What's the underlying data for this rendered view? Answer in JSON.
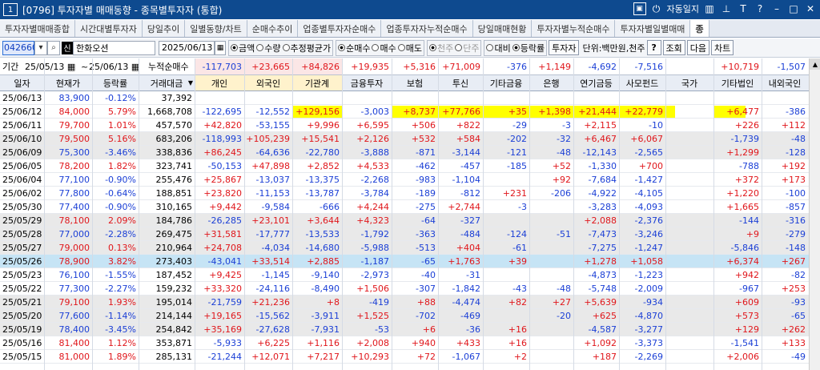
{
  "window": {
    "num": "1",
    "title": "[0796] 투자자별 매매동향 - 종목별투자자 (통합)",
    "autosave": "자동일지",
    "icons": [
      "window-box-icon",
      "power-icon",
      "pin-icon",
      "text-icon",
      "help-icon",
      "minimize-icon",
      "maximize-icon",
      "close-icon"
    ]
  },
  "tabs": [
    "투자자별매매종합",
    "시간대별투자자",
    "당일추이",
    "일별동향/차트",
    "순매수추이",
    "업종별투자자순매수",
    "업종투자자누적순매수",
    "당일매매현황",
    "투자자별누적순매수",
    "투자자별일별매매",
    "종"
  ],
  "controls": {
    "code": "042660",
    "market_badge": "신",
    "stock_name": "한화오션",
    "date": "2025/06/13",
    "metric_options": [
      "금액",
      "수량",
      "추정평균가"
    ],
    "metric_selected": 0,
    "trade_options": [
      "순매수",
      "매수",
      "매도"
    ],
    "trade_selected": 0,
    "scope_options": [
      "천주",
      "단주"
    ],
    "compare_options": [
      "대비",
      "등락률"
    ],
    "compare_selected": 1,
    "investor_button": "투자자",
    "unit": "단위:백만원,천주",
    "help": "?",
    "query": "조회",
    "next": "다음",
    "chart": "차트"
  },
  "period": {
    "label": "기간",
    "from": "25/05/13",
    "to": "25/06/13",
    "cum_label": "누적순매수",
    "cum_values": [
      "-117,703",
      "+23,665",
      "+84,826",
      "+19,935",
      "+5,316",
      "+71,009",
      "-376",
      "+1,149",
      "-4,692",
      "-7,516",
      "",
      "+10,719",
      "-1,507"
    ]
  },
  "columns": [
    "일자",
    "현재가",
    "등락률",
    "거래대금",
    "개인",
    "외국인",
    "기관계",
    "금융투자",
    "보험",
    "투신",
    "기타금융",
    "은행",
    "연기금등",
    "사모펀드",
    "국가",
    "기타법인",
    "내외국인"
  ],
  "rows": [
    {
      "d": "25/06/13",
      "p": "83,900",
      "r": "-0.12%",
      "a": "37,392",
      "v": [
        "",
        "",
        "",
        "",
        "",
        "",
        "",
        "",
        "",
        "",
        "",
        "",
        ""
      ]
    },
    {
      "d": "25/06/12",
      "p": "84,000",
      "r": "5.79%",
      "a": "1,668,708",
      "v": [
        "-122,695",
        "-12,552",
        "+129,156",
        "-3,003",
        "+8,737",
        "+77,766",
        "+35",
        "+1,398",
        "+21,444",
        "+22,779",
        "",
        "+6,477",
        "-386"
      ]
    },
    {
      "d": "25/06/11",
      "p": "79,700",
      "r": "1.01%",
      "a": "457,570",
      "v": [
        "+42,820",
        "-53,155",
        "+9,996",
        "+6,595",
        "+506",
        "+822",
        "-29",
        "-3",
        "+2,115",
        "-10",
        "",
        "+226",
        "+112"
      ]
    },
    {
      "d": "25/06/10",
      "p": "79,500",
      "r": "5.16%",
      "a": "683,206",
      "v": [
        "-118,993",
        "+105,239",
        "+15,541",
        "+2,126",
        "+532",
        "+584",
        "-202",
        "-32",
        "+6,467",
        "+6,067",
        "",
        "-1,739",
        "-48"
      ]
    },
    {
      "d": "25/06/09",
      "p": "75,300",
      "r": "-3.46%",
      "a": "338,836",
      "v": [
        "+86,245",
        "-64,636",
        "-22,780",
        "-3,888",
        "-871",
        "-3,144",
        "-121",
        "-48",
        "-12,143",
        "-2,565",
        "",
        "+1,299",
        "-128"
      ]
    },
    {
      "d": "25/06/05",
      "p": "78,200",
      "r": "1.82%",
      "a": "323,741",
      "v": [
        "-50,153",
        "+47,898",
        "+2,852",
        "+4,533",
        "-462",
        "-457",
        "-185",
        "+52",
        "-1,330",
        "+700",
        "",
        "-788",
        "+192"
      ]
    },
    {
      "d": "25/06/04",
      "p": "77,100",
      "r": "-0.90%",
      "a": "255,476",
      "v": [
        "+25,867",
        "-13,037",
        "-13,375",
        "-2,268",
        "-983",
        "-1,104",
        "",
        "+92",
        "-7,684",
        "-1,427",
        "",
        "+372",
        "+173"
      ]
    },
    {
      "d": "25/06/02",
      "p": "77,800",
      "r": "-0.64%",
      "a": "188,851",
      "v": [
        "+23,820",
        "-11,153",
        "-13,787",
        "-3,784",
        "-189",
        "-812",
        "+231",
        "-206",
        "-4,922",
        "-4,105",
        "",
        "+1,220",
        "-100"
      ]
    },
    {
      "d": "25/05/30",
      "p": "77,400",
      "r": "-0.90%",
      "a": "310,165",
      "v": [
        "+9,442",
        "-9,584",
        "-666",
        "+4,244",
        "-275",
        "+2,744",
        "-3",
        "",
        "-3,283",
        "-4,093",
        "",
        "+1,665",
        "-857"
      ]
    },
    {
      "d": "25/05/29",
      "p": "78,100",
      "r": "2.09%",
      "a": "184,786",
      "v": [
        "-26,285",
        "+23,101",
        "+3,644",
        "+4,323",
        "-64",
        "-327",
        "",
        "",
        "+2,088",
        "-2,376",
        "",
        "-144",
        "-316"
      ]
    },
    {
      "d": "25/05/28",
      "p": "77,000",
      "r": "-2.28%",
      "a": "269,475",
      "v": [
        "+31,581",
        "-17,777",
        "-13,533",
        "-1,792",
        "-363",
        "-484",
        "-124",
        "-51",
        "-7,473",
        "-3,246",
        "",
        "+9",
        "-279"
      ]
    },
    {
      "d": "25/05/27",
      "p": "79,000",
      "r": "0.13%",
      "a": "210,964",
      "v": [
        "+24,708",
        "-4,034",
        "-14,680",
        "-5,988",
        "-513",
        "+404",
        "-61",
        "",
        "-7,275",
        "-1,247",
        "",
        "-5,846",
        "-148"
      ]
    },
    {
      "d": "25/05/26",
      "p": "78,900",
      "r": "3.82%",
      "a": "273,403",
      "v": [
        "-43,041",
        "+33,514",
        "+2,885",
        "-1,187",
        "-65",
        "+1,763",
        "+39",
        "",
        "+1,278",
        "+1,058",
        "",
        "+6,374",
        "+267"
      ]
    },
    {
      "d": "25/05/23",
      "p": "76,100",
      "r": "-1.55%",
      "a": "187,452",
      "v": [
        "+9,425",
        "-1,145",
        "-9,140",
        "-2,973",
        "-40",
        "-31",
        "",
        "",
        "-4,873",
        "-1,223",
        "",
        "+942",
        "-82"
      ]
    },
    {
      "d": "25/05/22",
      "p": "77,300",
      "r": "-2.27%",
      "a": "159,232",
      "v": [
        "+33,320",
        "-24,116",
        "-8,490",
        "+1,506",
        "-307",
        "-1,842",
        "-43",
        "-48",
        "-5,748",
        "-2,009",
        "",
        "-967",
        "+253"
      ]
    },
    {
      "d": "25/05/21",
      "p": "79,100",
      "r": "1.93%",
      "a": "195,014",
      "v": [
        "-21,759",
        "+21,236",
        "+8",
        "-419",
        "+88",
        "-4,474",
        "+82",
        "+27",
        "+5,639",
        "-934",
        "",
        "+609",
        "-93"
      ]
    },
    {
      "d": "25/05/20",
      "p": "77,600",
      "r": "-1.14%",
      "a": "214,144",
      "v": [
        "+19,165",
        "-15,562",
        "-3,911",
        "+1,525",
        "-702",
        "-469",
        "",
        "-20",
        "+625",
        "-4,870",
        "",
        "+573",
        "-65"
      ]
    },
    {
      "d": "25/05/19",
      "p": "78,400",
      "r": "-3.45%",
      "a": "254,842",
      "v": [
        "+35,169",
        "-27,628",
        "-7,931",
        "-53",
        "+6",
        "-36",
        "+16",
        "",
        "-4,587",
        "-3,277",
        "",
        "+129",
        "+262"
      ]
    },
    {
      "d": "25/05/16",
      "p": "81,400",
      "r": "1.12%",
      "a": "353,871",
      "v": [
        "-5,933",
        "+6,225",
        "+1,116",
        "+2,008",
        "+940",
        "+433",
        "+16",
        "",
        "+1,092",
        "-3,373",
        "",
        "-1,541",
        "+133"
      ]
    },
    {
      "d": "25/05/15",
      "p": "81,000",
      "r": "1.89%",
      "a": "285,131",
      "v": [
        "-21,244",
        "+12,071",
        "+7,217",
        "+10,293",
        "+72",
        "-1,067",
        "+2",
        "",
        "+187",
        "-2,269",
        "",
        "+2,006",
        "-49"
      ]
    }
  ],
  "colors": {
    "positive": "#e0161b",
    "negative": "#1b3fd6",
    "highlight": "#ffff00",
    "titlebar": "#0e4a8f",
    "selected_row": "#c6e4f5"
  }
}
